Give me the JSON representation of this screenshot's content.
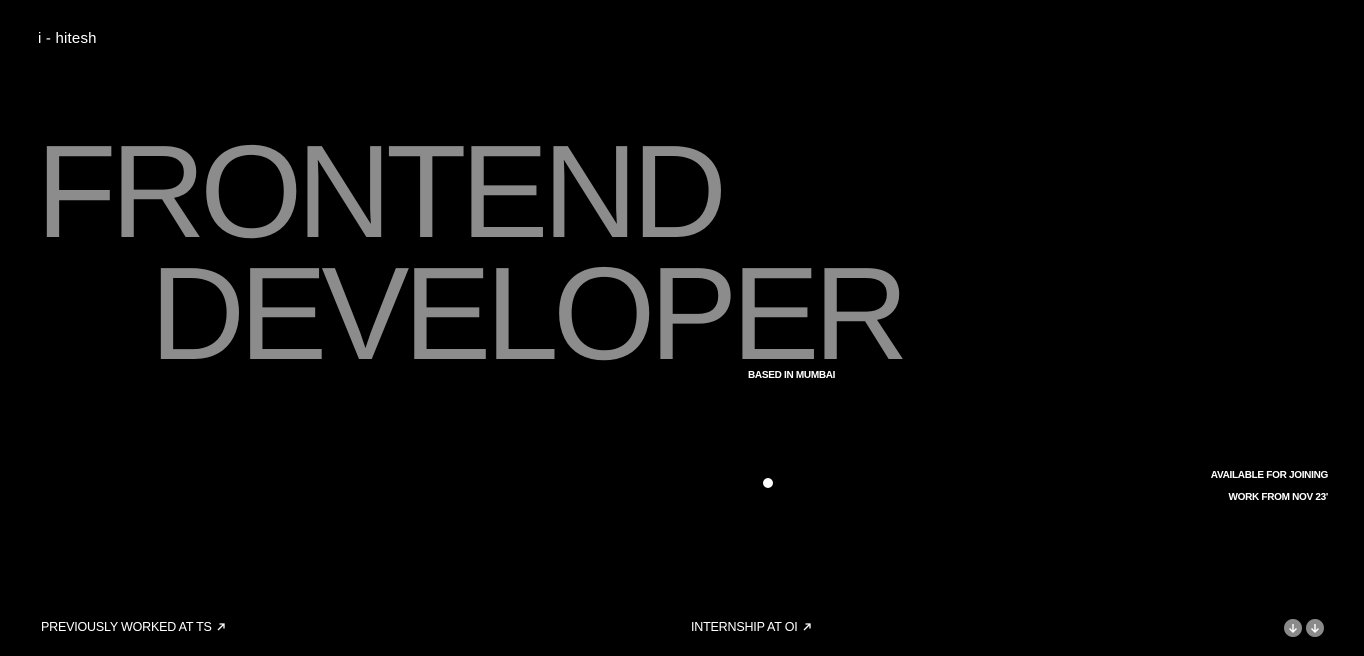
{
  "header": {
    "logo": "i - hitesh"
  },
  "hero": {
    "line1": "FRONTEND",
    "line2": "DEVELOPER",
    "location": "BASED IN MUMBAI"
  },
  "availability": {
    "line1": "AVAILABLE FOR JOINING",
    "line2": "WORK FROM NOV 23'"
  },
  "footer": {
    "previous_work": "PREVIOUSLY WORKED AT TS",
    "internship": "INTERNSHIP AT OI",
    "scroll_icons": [
      "arrow-down-icon",
      "arrow-down-icon"
    ]
  },
  "colors": {
    "background": "#000000",
    "hero_text": "#8c8c8c",
    "text": "#ffffff",
    "button": "#8a8a8a"
  }
}
